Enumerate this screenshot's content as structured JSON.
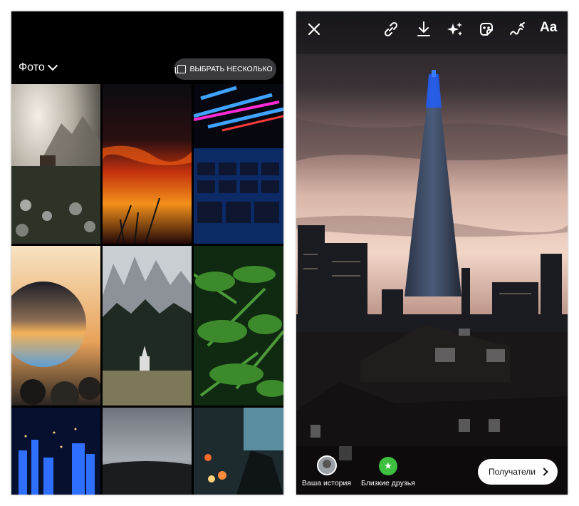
{
  "gallery": {
    "album_label": "Фото",
    "select_multiple_label": "ВЫБРАТЬ НЕСКОЛЬКО",
    "thumbnails": [
      {
        "subject": "foggy mountain meadow with cabin"
      },
      {
        "subject": "orange sunset clouds over silhouettes"
      },
      {
        "subject": "neon lights above keyboard keys"
      },
      {
        "subject": "crystal ball at sunset"
      },
      {
        "subject": "snowy mountains, forest and chapel"
      },
      {
        "subject": "green fern leaves"
      },
      {
        "subject": "night city with blue lights"
      },
      {
        "subject": "misty lake horizon"
      },
      {
        "subject": "blurred night street lights"
      }
    ]
  },
  "editor": {
    "toolbar": {
      "close_icon": "close-icon",
      "link_icon": "link-icon",
      "download_icon": "download-icon",
      "effects_icon": "sparkles-icon",
      "sticker_icon": "sticker-icon",
      "draw_icon": "draw-icon",
      "text_label": "Aa"
    },
    "share": {
      "your_story_label": "Ваша история",
      "close_friends_label": "Близкие друзья",
      "recipients_label": "Получатели"
    }
  },
  "colors": {
    "close_friends_green": "#3fbf3f",
    "button_bg": "#3a3a3c"
  }
}
